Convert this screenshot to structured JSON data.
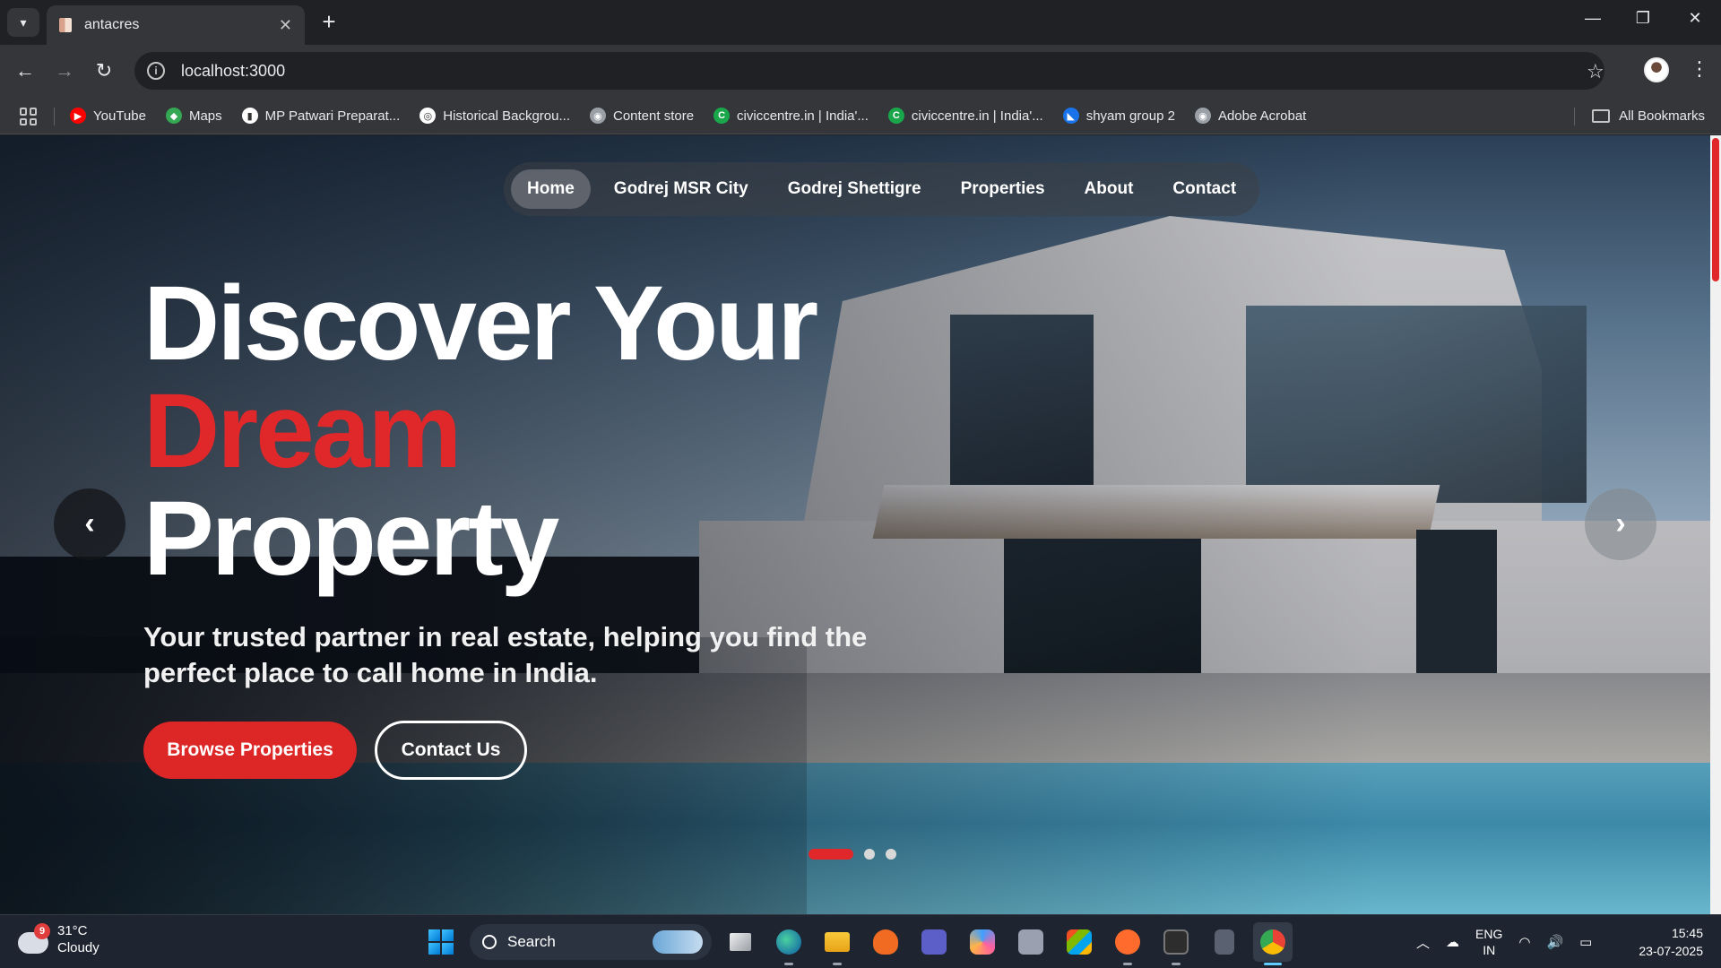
{
  "browser": {
    "tab_title": "antacres",
    "tab_close": "✕",
    "new_tab": "+",
    "url": "localhost:3000",
    "bookmarks": [
      {
        "label": "YouTube",
        "icon": "youtube-icon",
        "color": "#ff0000",
        "glyph": "▶"
      },
      {
        "label": "Maps",
        "icon": "maps-icon",
        "color": "#34a853",
        "glyph": "◆"
      },
      {
        "label": "MP Patwari Preparat...",
        "icon": "bookmark-favicon-icon",
        "color": "#ffffff",
        "glyph": "▮"
      },
      {
        "label": "Historical Backgrou...",
        "icon": "bookmark-favicon-icon",
        "color": "#ffffff",
        "glyph": "◎"
      },
      {
        "label": "Content store",
        "icon": "globe-icon",
        "color": "#9aa0a6",
        "glyph": "◉"
      },
      {
        "label": "civiccentre.in | India'...",
        "icon": "civiccentre-icon",
        "color": "#1aa64b",
        "glyph": "C"
      },
      {
        "label": "civiccentre.in | India'...",
        "icon": "civiccentre-icon",
        "color": "#1aa64b",
        "glyph": "C"
      },
      {
        "label": "shyam group 2",
        "icon": "bookmark-favicon-icon",
        "color": "#1a73e8",
        "glyph": "◣"
      },
      {
        "label": "Adobe Acrobat",
        "icon": "globe-icon",
        "color": "#9aa0a6",
        "glyph": "◉"
      }
    ],
    "all_bookmarks": "All Bookmarks"
  },
  "site": {
    "nav": [
      {
        "label": "Home",
        "active": true
      },
      {
        "label": "Godrej MSR City",
        "active": false
      },
      {
        "label": "Godrej Shettigre",
        "active": false
      },
      {
        "label": "Properties",
        "active": false
      },
      {
        "label": "About",
        "active": false
      },
      {
        "label": "Contact",
        "active": false
      }
    ],
    "headline_line1": "Discover Your",
    "headline_accent": "Dream",
    "headline_line3": "Property",
    "subtitle": "Your trusted partner in real estate, helping you find the perfect place to call home in India.",
    "primary_cta": "Browse Properties",
    "secondary_cta": "Contact Us",
    "prev_arrow": "‹",
    "next_arrow": "›",
    "slides_total": 3,
    "slide_active": 1,
    "accent_color": "#e0282b"
  },
  "taskbar": {
    "weather_badge": "9",
    "temperature": "31°C",
    "condition": "Cloudy",
    "search_label": "Search",
    "lang_primary": "ENG",
    "lang_region": "IN",
    "time": "15:45",
    "date": "23-07-2025"
  }
}
